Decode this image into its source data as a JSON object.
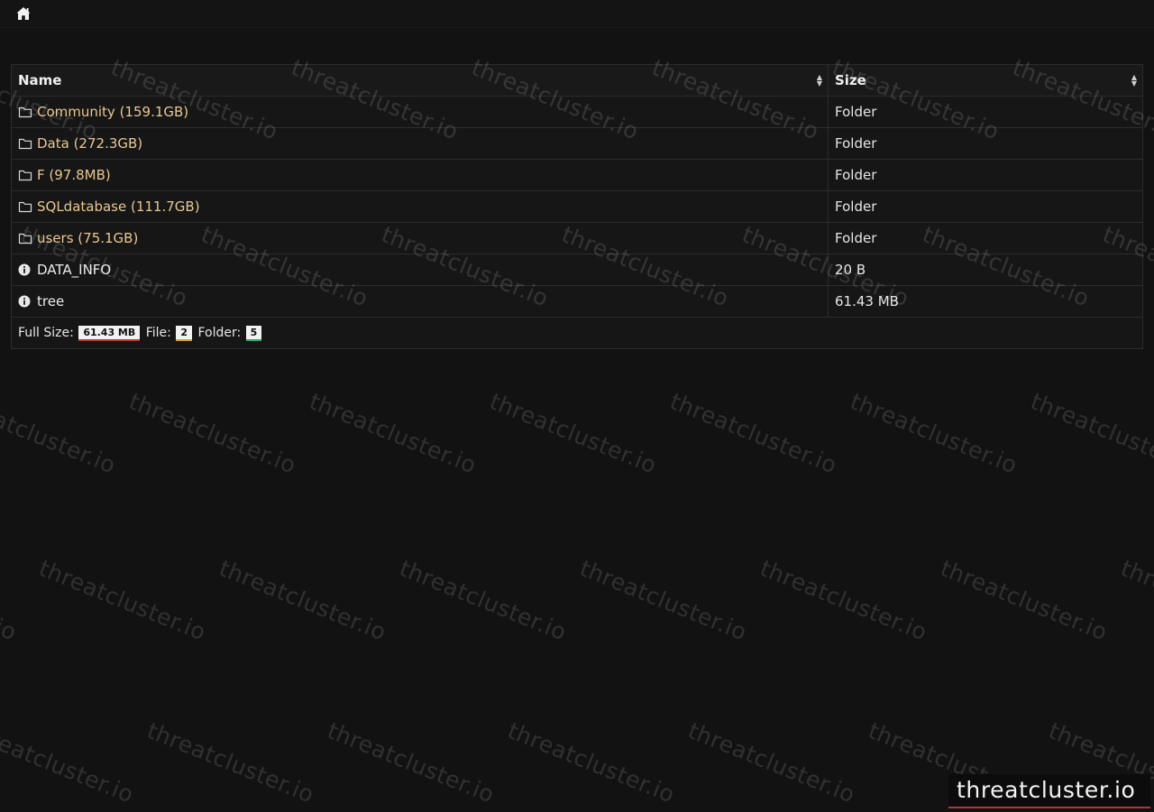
{
  "topbar": {
    "home_icon": "home-icon"
  },
  "table": {
    "columns": [
      {
        "label": "Name"
      },
      {
        "label": "Size"
      }
    ],
    "rows": [
      {
        "type": "folder",
        "name": "Community (159.1GB)",
        "size": "Folder",
        "icon": "folder-icon"
      },
      {
        "type": "folder",
        "name": "Data (272.3GB)",
        "size": "Folder",
        "icon": "folder-icon"
      },
      {
        "type": "folder",
        "name": "F (97.8MB)",
        "size": "Folder",
        "icon": "folder-icon"
      },
      {
        "type": "folder",
        "name": "SQLdatabase (111.7GB)",
        "size": "Folder",
        "icon": "folder-icon"
      },
      {
        "type": "folder",
        "name": "users (75.1GB)",
        "size": "Folder",
        "icon": "folder-icon"
      },
      {
        "type": "file",
        "name": "DATA_INFO",
        "size": "20 B",
        "icon": "info-icon"
      },
      {
        "type": "file",
        "name": "tree",
        "size": "61.43 MB",
        "icon": "info-icon"
      }
    ],
    "footer": {
      "full_size_label": "Full Size:",
      "full_size_value": "61.43 MB",
      "file_label": "File:",
      "file_count": "2",
      "folder_label": "Folder:",
      "folder_count": "5"
    }
  },
  "watermark": {
    "text": "threatcluster.io"
  },
  "logo": {
    "text": "threatcluster.io"
  },
  "colors": {
    "background": "#121212",
    "folder_link": "#e8c98f",
    "full_size_accent": "#c0392b",
    "file_accent": "#d6a21e",
    "folder_accent": "#27ae60"
  }
}
